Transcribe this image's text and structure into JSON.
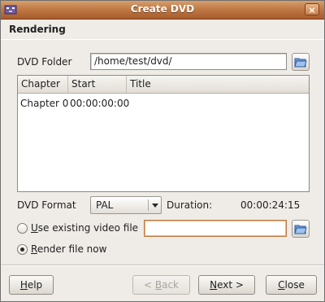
{
  "window": {
    "title": "Create DVD",
    "close_glyph": "×"
  },
  "header": {
    "title": "Rendering"
  },
  "dvd_folder": {
    "label": "DVD Folder",
    "value": "/home/test/dvd/"
  },
  "chapters": {
    "columns": [
      "Chapter",
      "Start",
      "Title"
    ],
    "rows": [
      {
        "chapter": "Chapter 0",
        "start": "00:00:00:00",
        "title": ""
      }
    ]
  },
  "format": {
    "label": "DVD Format",
    "selected": "PAL",
    "duration_label": "Duration:",
    "duration_value": "00:00:24:15"
  },
  "options": {
    "use_existing": {
      "prefix": "",
      "mnemonic": "U",
      "rest": "se existing video file",
      "checked": false,
      "value": ""
    },
    "render_now": {
      "mnemonic": "R",
      "rest": "ender file now",
      "checked": true
    }
  },
  "buttons": {
    "help": {
      "mnemonic": "H",
      "rest": "elp"
    },
    "back": {
      "prefix": "< ",
      "mnemonic": "B",
      "rest": "ack",
      "enabled": false
    },
    "next": {
      "mnemonic": "N",
      "rest": "ext >"
    },
    "close": {
      "mnemonic": "C",
      "rest": "lose"
    }
  },
  "icons": {
    "app": "dvd-app-icon",
    "folder": "open-folder-icon",
    "combo_arrow": "chevron-down-icon"
  },
  "colors": {
    "titlebar": "#c07a45",
    "window_bg": "#efebe7",
    "focus": "#c07a45"
  }
}
